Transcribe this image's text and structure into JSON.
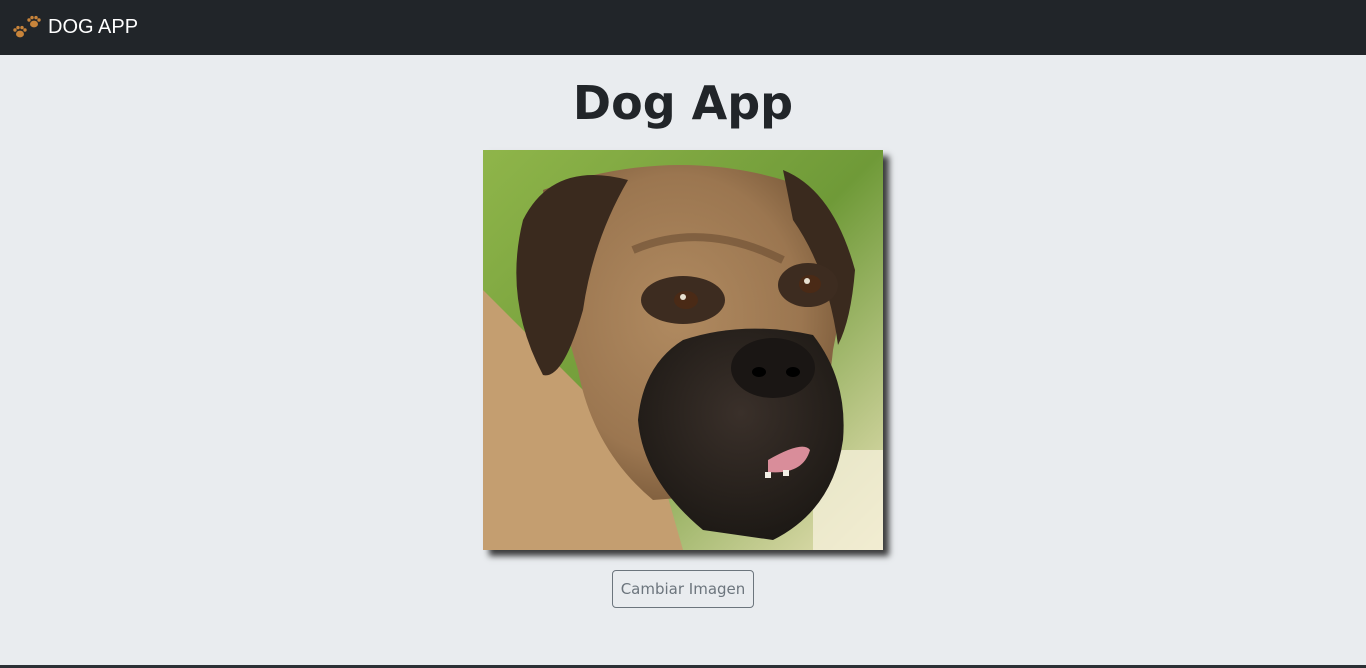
{
  "navbar": {
    "brand_label": "DOG APP",
    "brand_icon": "paw-prints-icon"
  },
  "main": {
    "title": "Dog App",
    "image_alt": "dog-photo",
    "change_button_label": "Cambiar Imagen"
  },
  "colors": {
    "navbar_bg": "#212529",
    "page_bg": "#e9ecef",
    "title_text": "#212529",
    "button_outline": "#6c757d",
    "paw_icon": "#c8843a"
  }
}
